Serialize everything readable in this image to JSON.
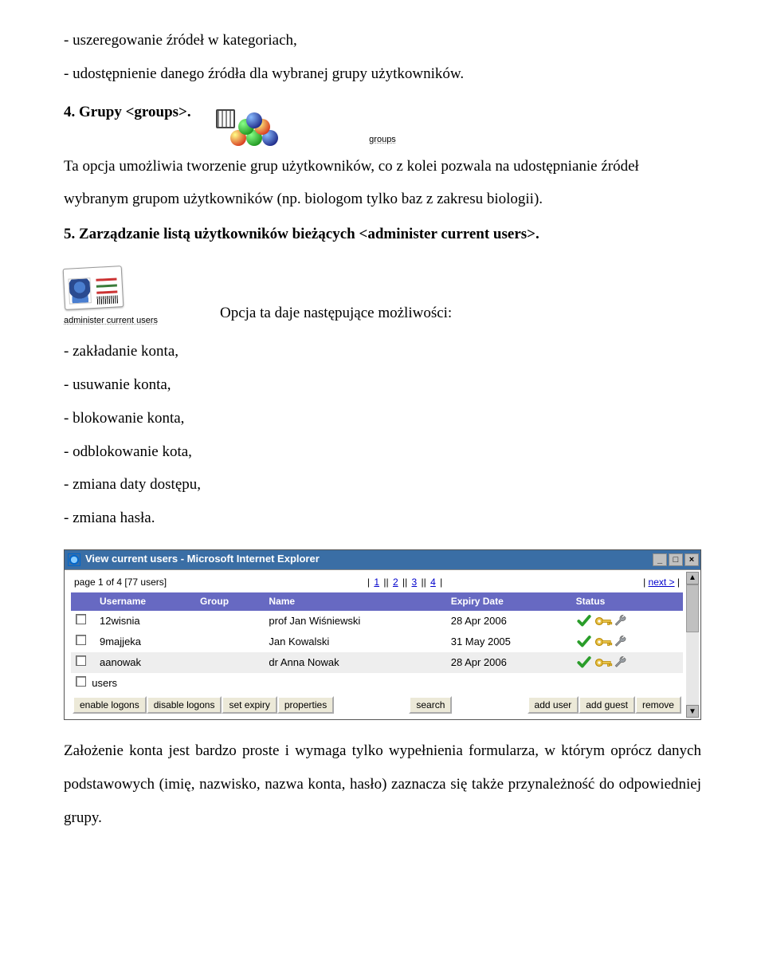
{
  "para1": "- uszeregowanie źródeł w kategoriach,",
  "para2": "- udostępnienie danego źródła dla wybranej grupy użytkowników.",
  "item4": {
    "label_bold": "4. Grupy <groups>.",
    "icon_caption": "groups",
    "text": "Ta opcja umożliwia tworzenie grup użytkowników, co z kolei pozwala na udostępnianie źródeł wybranym grupom użytkowników (np. biologom tylko baz z zakresu biologii)."
  },
  "item5": {
    "label_bold": "5. Zarządzanie listą użytkowników bieżących <administer current users>.",
    "icon_caption": "administer current users",
    "lead": "Opcja ta daje następujące możliwości:"
  },
  "bullets": [
    "- zakładanie konta,",
    "- usuwanie konta,",
    "- blokowanie konta,",
    "- odblokowanie kota,",
    "- zmiana daty dostępu,",
    "- zmiana hasła."
  ],
  "window": {
    "title": "View current users - Microsoft Internet Explorer",
    "page_info": "page 1 of 4 [77 users]",
    "pages": [
      "1",
      "2",
      "3",
      "4"
    ],
    "next": "next >",
    "headers": [
      "",
      "Username",
      "Group",
      "Name",
      "Expiry Date",
      "Status"
    ],
    "rows": [
      {
        "username": "12wisnia",
        "group": "",
        "name": "prof Jan Wiśniewski",
        "expiry": "28 Apr 2006"
      },
      {
        "username": "9majjeka",
        "group": "",
        "name": "Jan Kowalski",
        "expiry": "31 May 2005"
      },
      {
        "username": "aanowak",
        "group": "",
        "name": "dr Anna Nowak",
        "expiry": "28 Apr 2006"
      }
    ],
    "bulk_label": "users",
    "buttons_left": [
      "enable logons",
      "disable logons",
      "set expiry",
      "properties"
    ],
    "button_center": "search",
    "buttons_right": [
      "add user",
      "add guest",
      "remove"
    ]
  },
  "closing": "Założenie konta jest bardzo proste i wymaga tylko wypełnienia formularza, w którym oprócz danych podstawowych (imię, nazwisko, nazwa konta, hasło) zaznacza się także przynależność do odpowiedniej grupy."
}
